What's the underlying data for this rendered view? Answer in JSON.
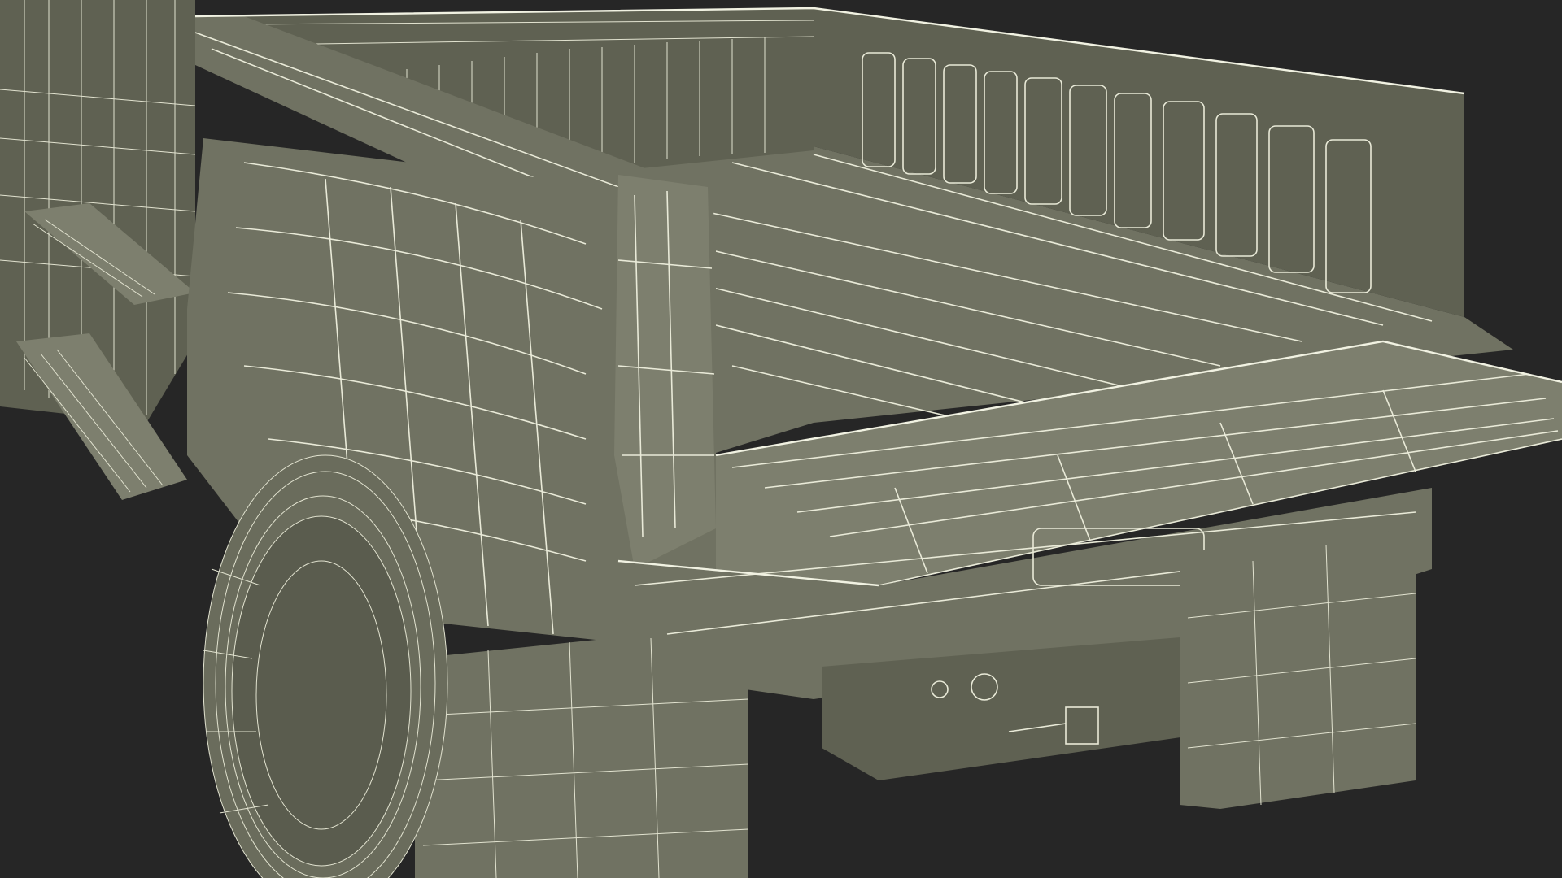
{
  "scene": {
    "subject": "pickup-truck-rear-wireframe",
    "colors": {
      "background": "#262626",
      "surface": "#707262",
      "surface_dark": "#5f6152",
      "surface_light": "#7d7f6e",
      "wire": "#e9ead8"
    }
  }
}
